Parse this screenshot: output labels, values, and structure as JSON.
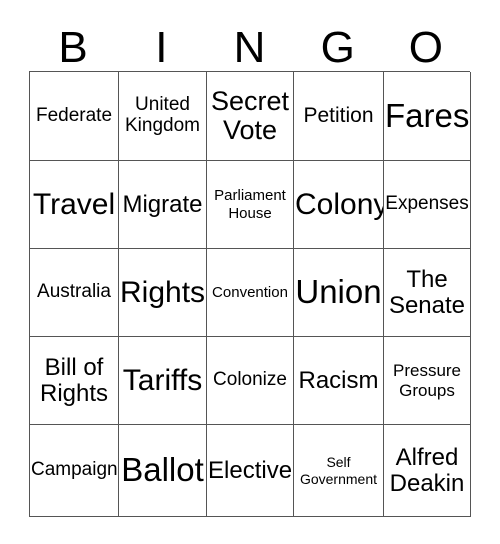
{
  "card": {
    "title": "BINGO",
    "header_letters": [
      "B",
      "I",
      "N",
      "G",
      "O"
    ],
    "rows": [
      [
        {
          "text": "Federate",
          "size": "fs-m"
        },
        {
          "text": "United\nKingdom",
          "size": "fs-m"
        },
        {
          "text": "Secret\nVote",
          "size": "fs-xl"
        },
        {
          "text": "Petition",
          "size": "fs-ml"
        },
        {
          "text": "Fares",
          "size": "fs-xxxl"
        }
      ],
      [
        {
          "text": "Travel",
          "size": "fs-xxl"
        },
        {
          "text": "Migrate",
          "size": "fs-l"
        },
        {
          "text": "Parliament\nHouse",
          "size": "fs-s"
        },
        {
          "text": "Colony",
          "size": "fs-xxl"
        },
        {
          "text": "Expenses",
          "size": "fs-m"
        }
      ],
      [
        {
          "text": "Australia",
          "size": "fs-m"
        },
        {
          "text": "Rights",
          "size": "fs-xxl"
        },
        {
          "text": "Convention",
          "size": "fs-s"
        },
        {
          "text": "Union",
          "size": "fs-xxxl"
        },
        {
          "text": "The\nSenate",
          "size": "fs-l"
        }
      ],
      [
        {
          "text": "Bill of\nRights",
          "size": "fs-l"
        },
        {
          "text": "Tariffs",
          "size": "fs-xxl"
        },
        {
          "text": "Colonize",
          "size": "fs-m"
        },
        {
          "text": "Racism",
          "size": "fs-l"
        },
        {
          "text": "Pressure\nGroups",
          "size": "fs-sm"
        }
      ],
      [
        {
          "text": "Campaign",
          "size": "fs-m"
        },
        {
          "text": "Ballot",
          "size": "fs-xxxl"
        },
        {
          "text": "Elective",
          "size": "fs-l"
        },
        {
          "text": "Self\nGovernment",
          "size": "fs-xs"
        },
        {
          "text": "Alfred\nDeakin",
          "size": "fs-l"
        }
      ]
    ]
  },
  "colors": {
    "background": "#ffffff",
    "text": "#000000",
    "grid_line": "#555555"
  }
}
